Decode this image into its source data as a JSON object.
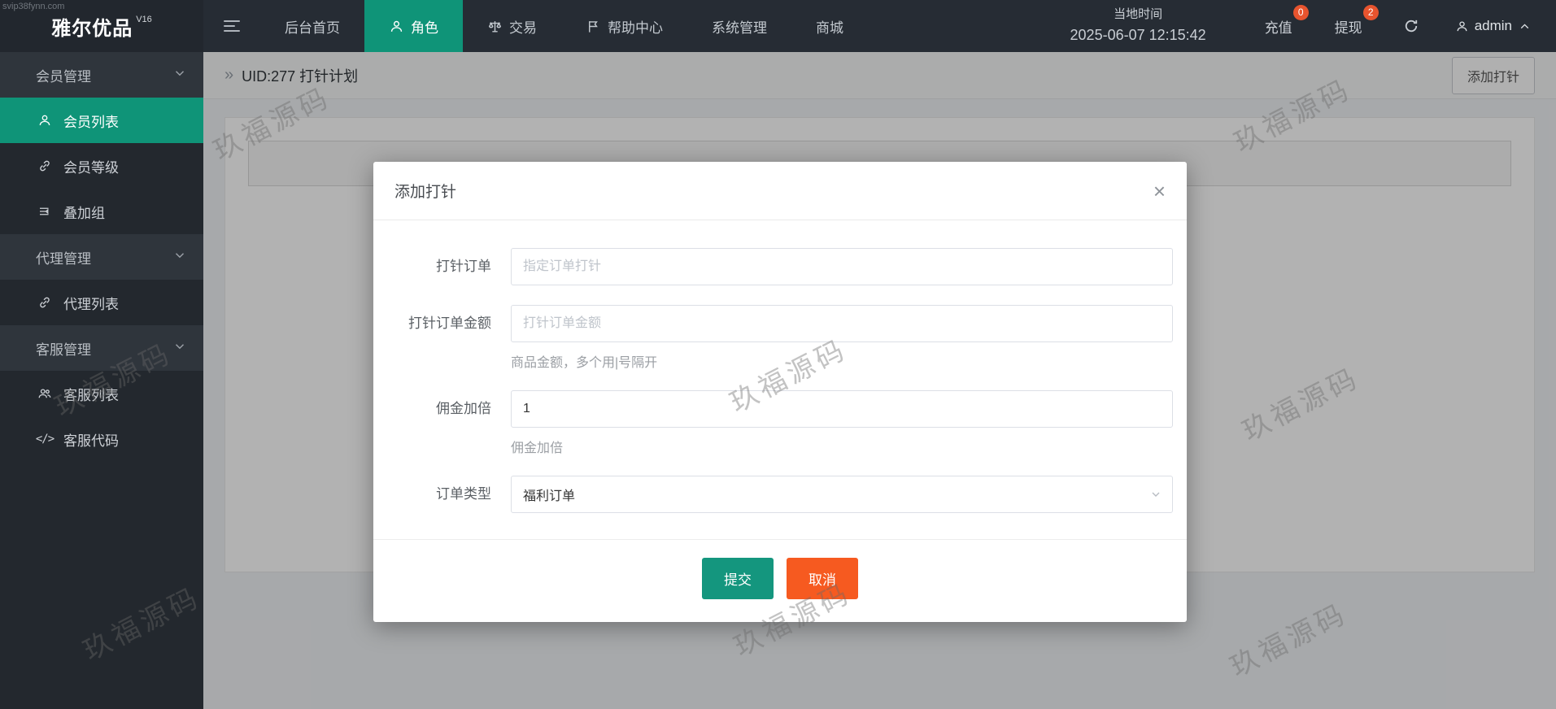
{
  "watermark": {
    "text": "玖福源码",
    "corner": "svip38fynn.com"
  },
  "topbar": {
    "logo": "雅尔优品",
    "logo_version": "V16",
    "nav": [
      {
        "label": "后台首页"
      },
      {
        "label": "角色"
      },
      {
        "label": "交易"
      },
      {
        "label": "帮助中心"
      },
      {
        "label": "系统管理"
      },
      {
        "label": "商城"
      }
    ],
    "time_label": "当地时间",
    "time_value": "2025-06-07 12:15:42",
    "recharge": {
      "label": "充值",
      "badge": "0"
    },
    "withdraw": {
      "label": "提现",
      "badge": "2"
    },
    "user": "admin"
  },
  "sidebar": {
    "items": [
      {
        "label": "会员管理"
      },
      {
        "label": "会员列表"
      },
      {
        "label": "会员等级"
      },
      {
        "label": "叠加组"
      },
      {
        "label": "代理管理"
      },
      {
        "label": "代理列表"
      },
      {
        "label": "客服管理"
      },
      {
        "label": "客服列表"
      },
      {
        "label": "客服代码"
      }
    ]
  },
  "content": {
    "breadcrumb_marker": "»",
    "breadcrumb": "UID:277 打针计划",
    "add_button": "添加打针"
  },
  "modal": {
    "title": "添加打针",
    "close": "×",
    "fields": [
      {
        "label": "打针订单",
        "placeholder": "指定订单打针"
      },
      {
        "label": "打针订单金额",
        "placeholder": "打针订单金额",
        "hint": "商品金额，多个用|号隔开"
      },
      {
        "label": "佣金加倍",
        "value": "1",
        "hint": "佣金加倍"
      },
      {
        "label": "订单类型",
        "value": "福利订单"
      }
    ],
    "submit": "提交",
    "cancel": "取消"
  },
  "colors": {
    "theme_teal": "#0f9478",
    "submit_green": "#14967e",
    "cancel_orange": "#f65a20",
    "badge_orange": "#e8542e",
    "topbar_bg": "#262c34",
    "sidebar_bg": "#23282e"
  }
}
